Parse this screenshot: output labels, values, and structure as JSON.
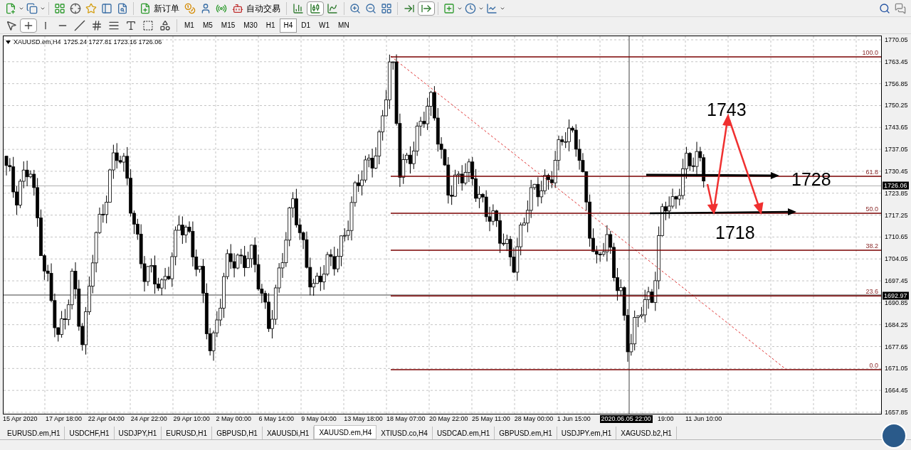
{
  "toolbar": {
    "order_button": "新订单",
    "autotrade_button": "自动交易"
  },
  "chart_modes": [
    {
      "kind": "bars",
      "selected": false
    },
    {
      "kind": "candles",
      "selected": true
    },
    {
      "kind": "line",
      "selected": false
    }
  ],
  "scroll_modes": [
    {
      "kind": "autoscroll",
      "selected": false
    },
    {
      "kind": "shift",
      "selected": true
    }
  ],
  "drawing_tools": [
    {
      "kind": "cursor",
      "selected": false
    },
    {
      "kind": "crosshair",
      "selected": true
    },
    {
      "kind": "vline",
      "selected": false
    },
    {
      "kind": "hline",
      "selected": false
    },
    {
      "kind": "trendline",
      "selected": false
    },
    {
      "kind": "channel",
      "selected": false
    },
    {
      "kind": "fibo",
      "selected": false
    },
    {
      "kind": "text",
      "selected": false
    },
    {
      "kind": "label",
      "selected": false
    },
    {
      "kind": "shapes",
      "selected": false
    }
  ],
  "timeframes": [
    {
      "label": "M1",
      "selected": false
    },
    {
      "label": "M5",
      "selected": false
    },
    {
      "label": "M15",
      "selected": false
    },
    {
      "label": "M30",
      "selected": false
    },
    {
      "label": "H1",
      "selected": false
    },
    {
      "label": "H4",
      "selected": true
    },
    {
      "label": "D1",
      "selected": false
    },
    {
      "label": "W1",
      "selected": false
    },
    {
      "label": "MN",
      "selected": false
    }
  ],
  "chart": {
    "symbol": "XAUUSD.em,H4",
    "ohlc": "1725.24 1727.81 1723.16 1726.06",
    "price_axis": [
      "1770.05",
      "1763.45",
      "1756.85",
      "1750.25",
      "1743.65",
      "1737.05",
      "1730.45",
      "1723.85",
      "1717.25",
      "1710.65",
      "1704.05",
      "1697.45",
      "1690.85",
      "1684.25",
      "1677.65",
      "1671.05",
      "1664.45",
      "1657.85"
    ],
    "price_badges": [
      "1726.06",
      "1692.97"
    ],
    "fib_levels": [
      "100.0",
      "61.8",
      "50.0",
      "38.2",
      "23.6",
      "0.0"
    ],
    "annotations": [
      "1743",
      "1728",
      "1718"
    ],
    "time_axis": [
      {
        "label": "15 Apr 2020",
        "kind": "tick"
      },
      {
        "label": "17 Apr 18:00",
        "kind": "tick"
      },
      {
        "label": "22 Apr 04:00",
        "kind": "tick"
      },
      {
        "label": "24 Apr 22:00",
        "kind": "tick"
      },
      {
        "label": "29 Apr 10:00",
        "kind": "tick"
      },
      {
        "label": "2 May 00:00",
        "kind": "tick"
      },
      {
        "label": "6 May 14:00",
        "kind": "tick"
      },
      {
        "label": "9 May 04:00",
        "kind": "tick"
      },
      {
        "label": "13 May 18:00",
        "kind": "tick"
      },
      {
        "label": "18 May 07:00",
        "kind": "tick"
      },
      {
        "label": "20 May 22:00",
        "kind": "tick"
      },
      {
        "label": "25 May 11:00",
        "kind": "tick"
      },
      {
        "label": "28 May 00:00",
        "kind": "tick"
      },
      {
        "label": "1 Jun 15:00",
        "kind": "tick"
      },
      {
        "label": "2020.06.05 22:00",
        "kind": "cursor"
      },
      {
        "label": "19:00",
        "kind": "tick"
      },
      {
        "label": "11 Jun 10:00",
        "kind": "tick"
      }
    ]
  },
  "tabs": [
    {
      "label": "EURUSD.em,H1",
      "selected": false
    },
    {
      "label": "USDCHF,H1",
      "selected": false
    },
    {
      "label": "USDJPY,H1",
      "selected": false
    },
    {
      "label": "EURUSD,H1",
      "selected": false
    },
    {
      "label": "GBPUSD,H1",
      "selected": false
    },
    {
      "label": "XAUUSDi,H1",
      "selected": false
    },
    {
      "label": "XAUUSD.em,H4",
      "selected": true
    },
    {
      "label": "XTIUSD.co,H4",
      "selected": false
    },
    {
      "label": "USDCAD.em,H1",
      "selected": false
    },
    {
      "label": "GBPUSD.em,H1",
      "selected": false
    },
    {
      "label": "USDJPY.em,H1",
      "selected": false
    },
    {
      "label": "XAGUSD.b2,H1",
      "selected": false
    }
  ]
}
